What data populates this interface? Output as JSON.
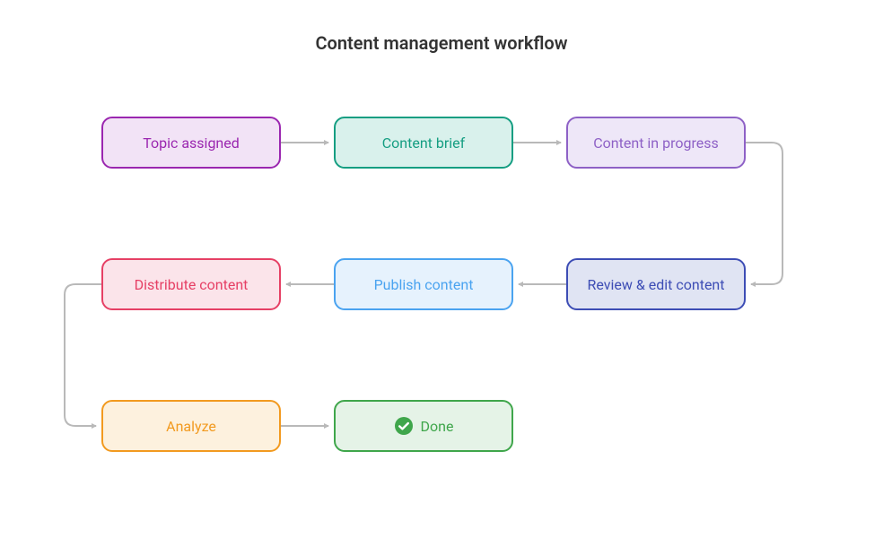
{
  "title": "Content management workflow",
  "nodes": {
    "topic_assigned": {
      "label": "Topic assigned",
      "border": "#9b27b0",
      "fill": "#f2e3f6",
      "text": "#9b27b0"
    },
    "content_brief": {
      "label": "Content brief",
      "border": "#159e82",
      "fill": "#d9f1ec",
      "text": "#159e82"
    },
    "content_progress": {
      "label": "Content in progress",
      "border": "#8e61c6",
      "fill": "#eee7f8",
      "text": "#8e61c6"
    },
    "review_edit": {
      "label": "Review & edit content",
      "border": "#3d4db5",
      "fill": "#e0e4f3",
      "text": "#3d4db5"
    },
    "publish": {
      "label": "Publish content",
      "border": "#4aa3f0",
      "fill": "#e6f2fd",
      "text": "#4aa3f0"
    },
    "distribute": {
      "label": "Distribute content",
      "border": "#e64065",
      "fill": "#fbe4ea",
      "text": "#e64065"
    },
    "analyze": {
      "label": "Analyze",
      "border": "#f29a1f",
      "fill": "#fdf1de",
      "text": "#f29a1f"
    },
    "done": {
      "label": "Done",
      "border": "#3fa64b",
      "fill": "#e5f3e7",
      "text": "#3fa64b"
    }
  },
  "icons": {
    "done_check": "check-circle"
  },
  "arrow_color": "#b9b9b9"
}
